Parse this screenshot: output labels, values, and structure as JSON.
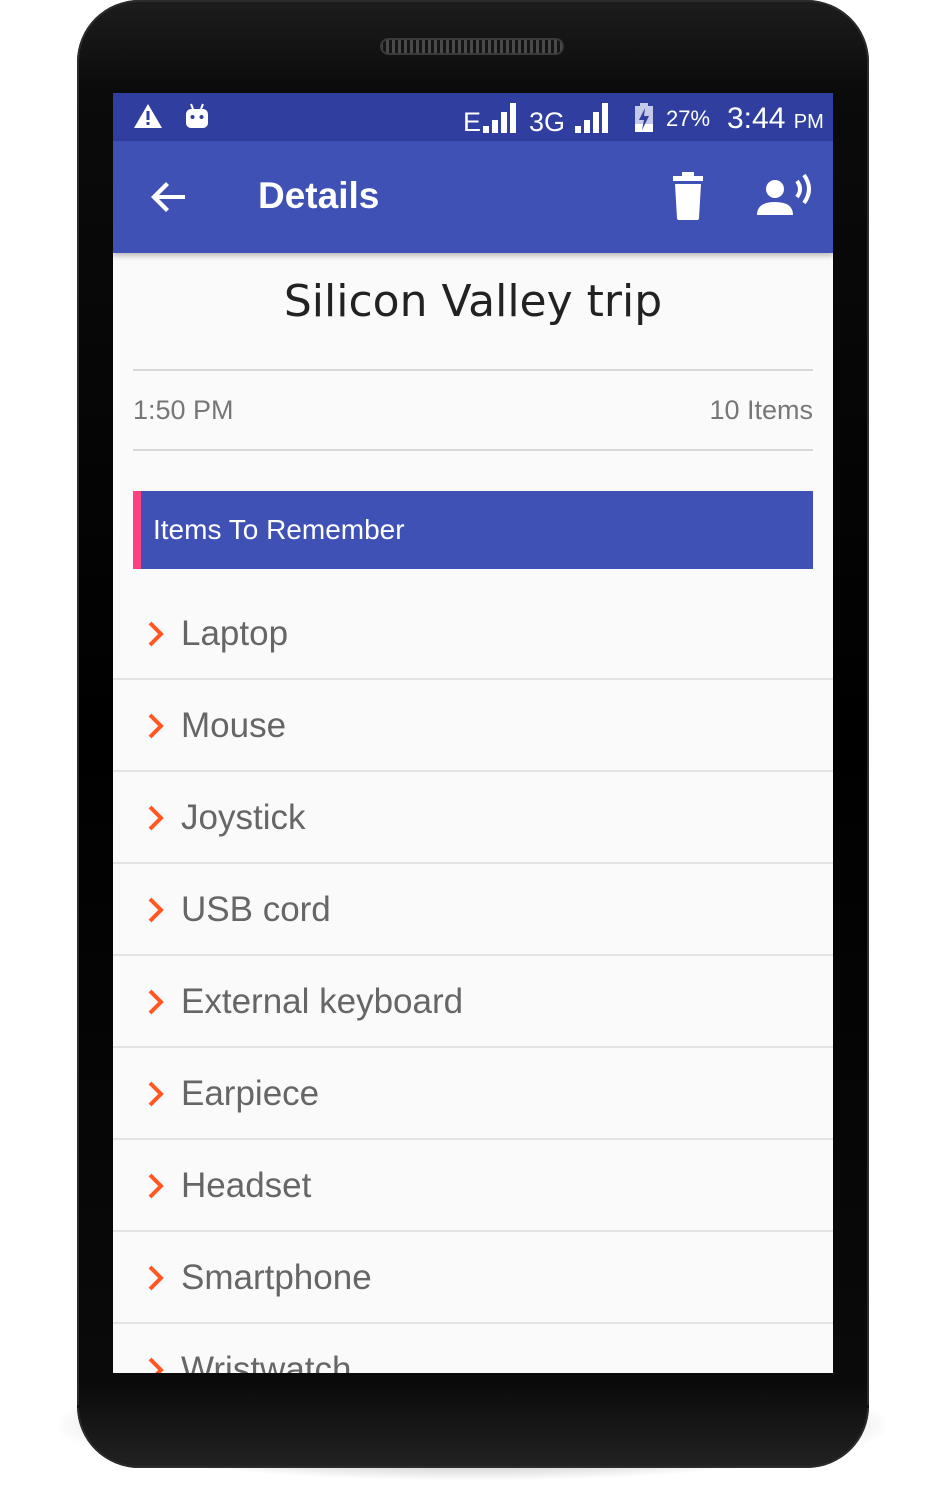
{
  "status_bar": {
    "network_e": "E",
    "network_3g": "3G",
    "battery_percent": "27%",
    "time": "3:44",
    "ampm": "PM"
  },
  "app_bar": {
    "title": "Details",
    "icons": [
      "back-arrow-icon",
      "trash-icon",
      "speak-icon"
    ]
  },
  "note": {
    "title": "Silicon Valley trip",
    "time": "1:50 PM",
    "count": "10 Items",
    "section_header": "Items To Remember",
    "items": [
      "Laptop",
      "Mouse",
      "Joystick",
      "USB cord",
      "External keyboard",
      "Earpiece",
      "Headset",
      "Smartphone",
      "Wristwatch"
    ]
  },
  "colors": {
    "primary": "#3f51b5",
    "primary_dark": "#303f9f",
    "accent": "#ff4081",
    "chevron": "#ff5722"
  }
}
